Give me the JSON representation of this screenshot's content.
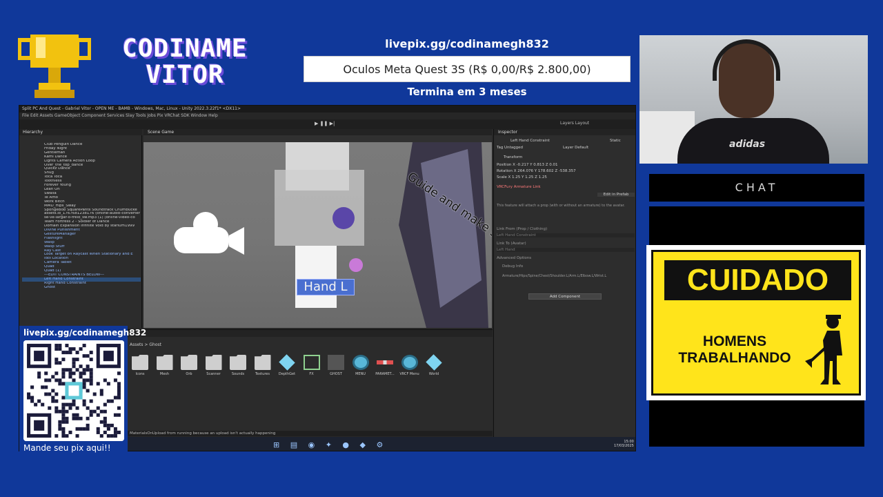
{
  "overlay": {
    "logo_line1": "CODINAME",
    "logo_line2": "VITOR",
    "goal_url": "livepix.gg/codinamegh832",
    "goal_item": "Oculos Meta Quest 3S (R$ 0,00/R$ 2.800,00)",
    "goal_ends": "Termina em 3 meses",
    "chat_label": "CHAT",
    "qr_url": "livepix.gg/codinamegh832",
    "qr_caption": "Mande seu pix aqui!!",
    "sign_title": "CUIDADO",
    "sign_line1": "HOMENS",
    "sign_line2": "TRABALHANDO",
    "webcam_shirt": "adidas"
  },
  "unity": {
    "title": "Split PC And Quest - Gabriel Vitor - OPEN ME - BAMB - Windows, Mac, Linux - Unity 2022.3.22f1* <DX11>",
    "menu": "File  Edit  Assets  GameObject  Component  Services  Slay  Tools  Jobs  Pix  VRChat SDK  Window  Help",
    "play_controls": "▶ ❚❚ ▶|",
    "toolbar_right": "Layers    Layout",
    "hierarchy_tab": "Hierarchy",
    "hierarchy_items": [
      "Club Penguin Dance",
      "Friday Night",
      "Gentleman",
      "Kami Dance",
      "Lights Camera Action Loop",
      "Over_the_top_dance",
      "Quickz Dance",
      "Snug",
      "Toca Toca",
      "Toothless",
      "Forever Young",
      "Lean On",
      "Swalla",
      "Te Amo",
      "Work Bitch",
      "MMD_Hips_Sway",
      "SpongeBob SquarePants Soundtrack Chumbucke",
      "assets.io_1767681238176 (online-audio-converter",
      "se-ve-largar-o-freio_sw.mp3 (1) (online-video-co",
      "Team Fortress 2 - Soldier of Dance",
      "Domain Expansion Infinite Void by starlum1999",
      "Divine Punishment",
      "GestureManager",
      "Flashlight",
      "Wasp",
      "Wasp Stuff",
      "Ray Cast",
      "Look Target on Raycast When Stationary and E",
      "Idol Location",
      "Camera Tablet",
      "Quad",
      "Quad (1)",
      "---EDIT CONSTRAINTS BELOW---",
      "Left Hand Constraint",
      "Right Hand Constraint",
      "Ghost"
    ],
    "scene_tabs": "Scene   Game",
    "hand_label": "Hand L",
    "scene_overlay_text": "Guide and make sure to prevent errors.",
    "inspector_tab": "Inspector",
    "inspector_object": "Left Hand Constraint",
    "inspector_static": "Static",
    "inspector_tag": "Tag  Untagged",
    "inspector_layer": "Layer  Default",
    "transform_label": "Transform",
    "position": "Position   X -0.217   Y 0.813   Z 0.01",
    "rotation": "Rotation   X 264.076   Y 178.602   Z -538.357",
    "scale": "Scale   X 1.25   Y 1.25   Z 1.25",
    "component": "VRCFury  Armature Link",
    "edit_prefab": "Edit in Prefab",
    "desc": "This feature will attach a prop (with or without an armature) to the avatar.",
    "link_from": "Link From (Prop / Clothing)",
    "link_from_val": "Left Hand Constraint",
    "link_to": "Link To (Avatar)",
    "link_to_val": "Left Hand",
    "advanced": "Advanced Options",
    "debug": "Debug Info",
    "debug_path": "Armature/Hips/Spine/Chest/Shoulder.L/Arm.L/Elbow.L/Wrist.L",
    "add_component": "Add Component",
    "project_path": "Assets  >  Ghost",
    "assets": [
      "Icons",
      "Mesh",
      "Orb",
      "Scanner",
      "Sounds",
      "Textures",
      "DepthGet",
      "FX",
      "GHOST",
      "MENU",
      "PARAMET...",
      "VRCF Menu",
      "World"
    ],
    "status": "MaterialsOnUpload from running because an upload isn't actually happening",
    "clock_time": "15:00",
    "clock_date": "17/03/2025"
  }
}
